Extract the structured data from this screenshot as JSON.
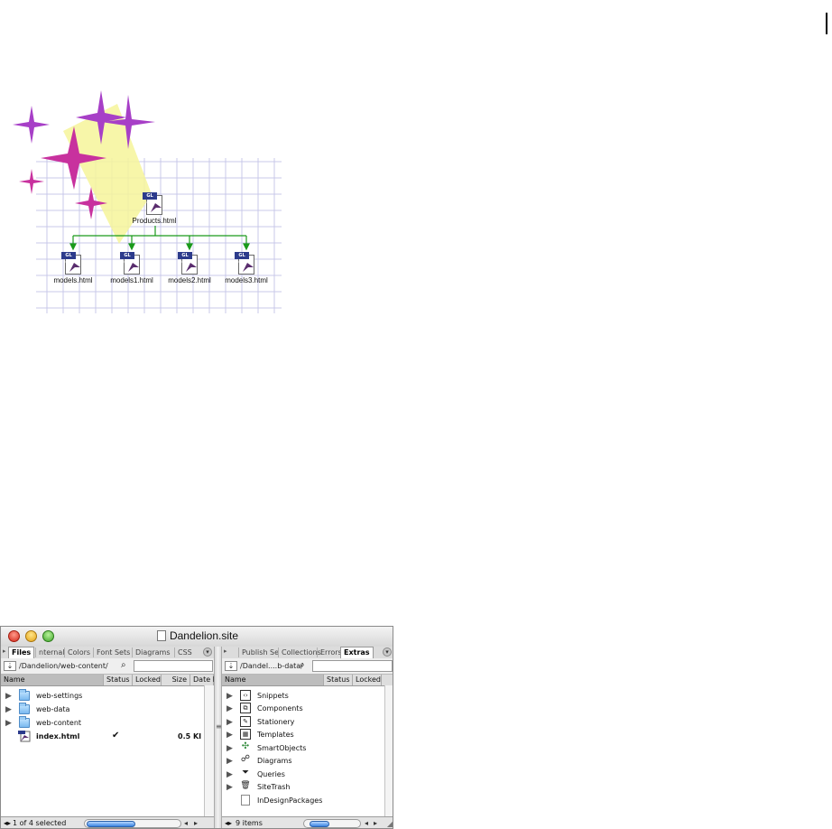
{
  "illustration": {
    "root": "Products.html",
    "children": [
      "models.html",
      "models1.html",
      "models2.html",
      "models3.html"
    ],
    "doc_tag": "GL CS"
  },
  "window": {
    "title": "Dandelion.site",
    "left_pane": {
      "tabs": [
        "Files",
        "nternal",
        "Colors",
        "Font Sets",
        "Diagrams",
        "CSS"
      ],
      "path": "/Dandelion/web-content/",
      "columns": [
        "Name",
        "Status",
        "Locked",
        "Size",
        "Date M"
      ],
      "rows": [
        {
          "name": "web-settings",
          "type": "folder",
          "status": "",
          "size": ""
        },
        {
          "name": "web-data",
          "type": "folder",
          "status": "",
          "size": ""
        },
        {
          "name": "web-content",
          "type": "folder",
          "status": "",
          "size": ""
        },
        {
          "name": "index.html",
          "type": "file",
          "status": "✔",
          "size": "0.5 KI"
        }
      ],
      "status": "1 of 4 selected"
    },
    "right_pane": {
      "tabs": [
        "Publish Se",
        "Collections",
        "Errors",
        "Extras"
      ],
      "path": "/Dandel....b-data/",
      "columns": [
        "Name",
        "Status",
        "Locked"
      ],
      "rows": [
        {
          "name": "Snippets",
          "icon": "‹›"
        },
        {
          "name": "Components",
          "icon": "⧉"
        },
        {
          "name": "Stationery",
          "icon": "✎"
        },
        {
          "name": "Templates",
          "icon": "▦"
        },
        {
          "name": "SmartObjects",
          "icon": "✣"
        },
        {
          "name": "Diagrams",
          "icon": "☍"
        },
        {
          "name": "Queries",
          "icon": "⏷"
        },
        {
          "name": "SiteTrash",
          "icon": "🗑"
        },
        {
          "name": "InDesignPackages",
          "icon": ""
        }
      ],
      "status": "9 items"
    }
  },
  "colors": {
    "arrow_green": "#1a9a1a",
    "sparkle_magenta": "#c8319e",
    "sparkle_purple": "#a73fc7",
    "grid": "#c9c9ea",
    "accent_blue": "#3a84e2"
  }
}
